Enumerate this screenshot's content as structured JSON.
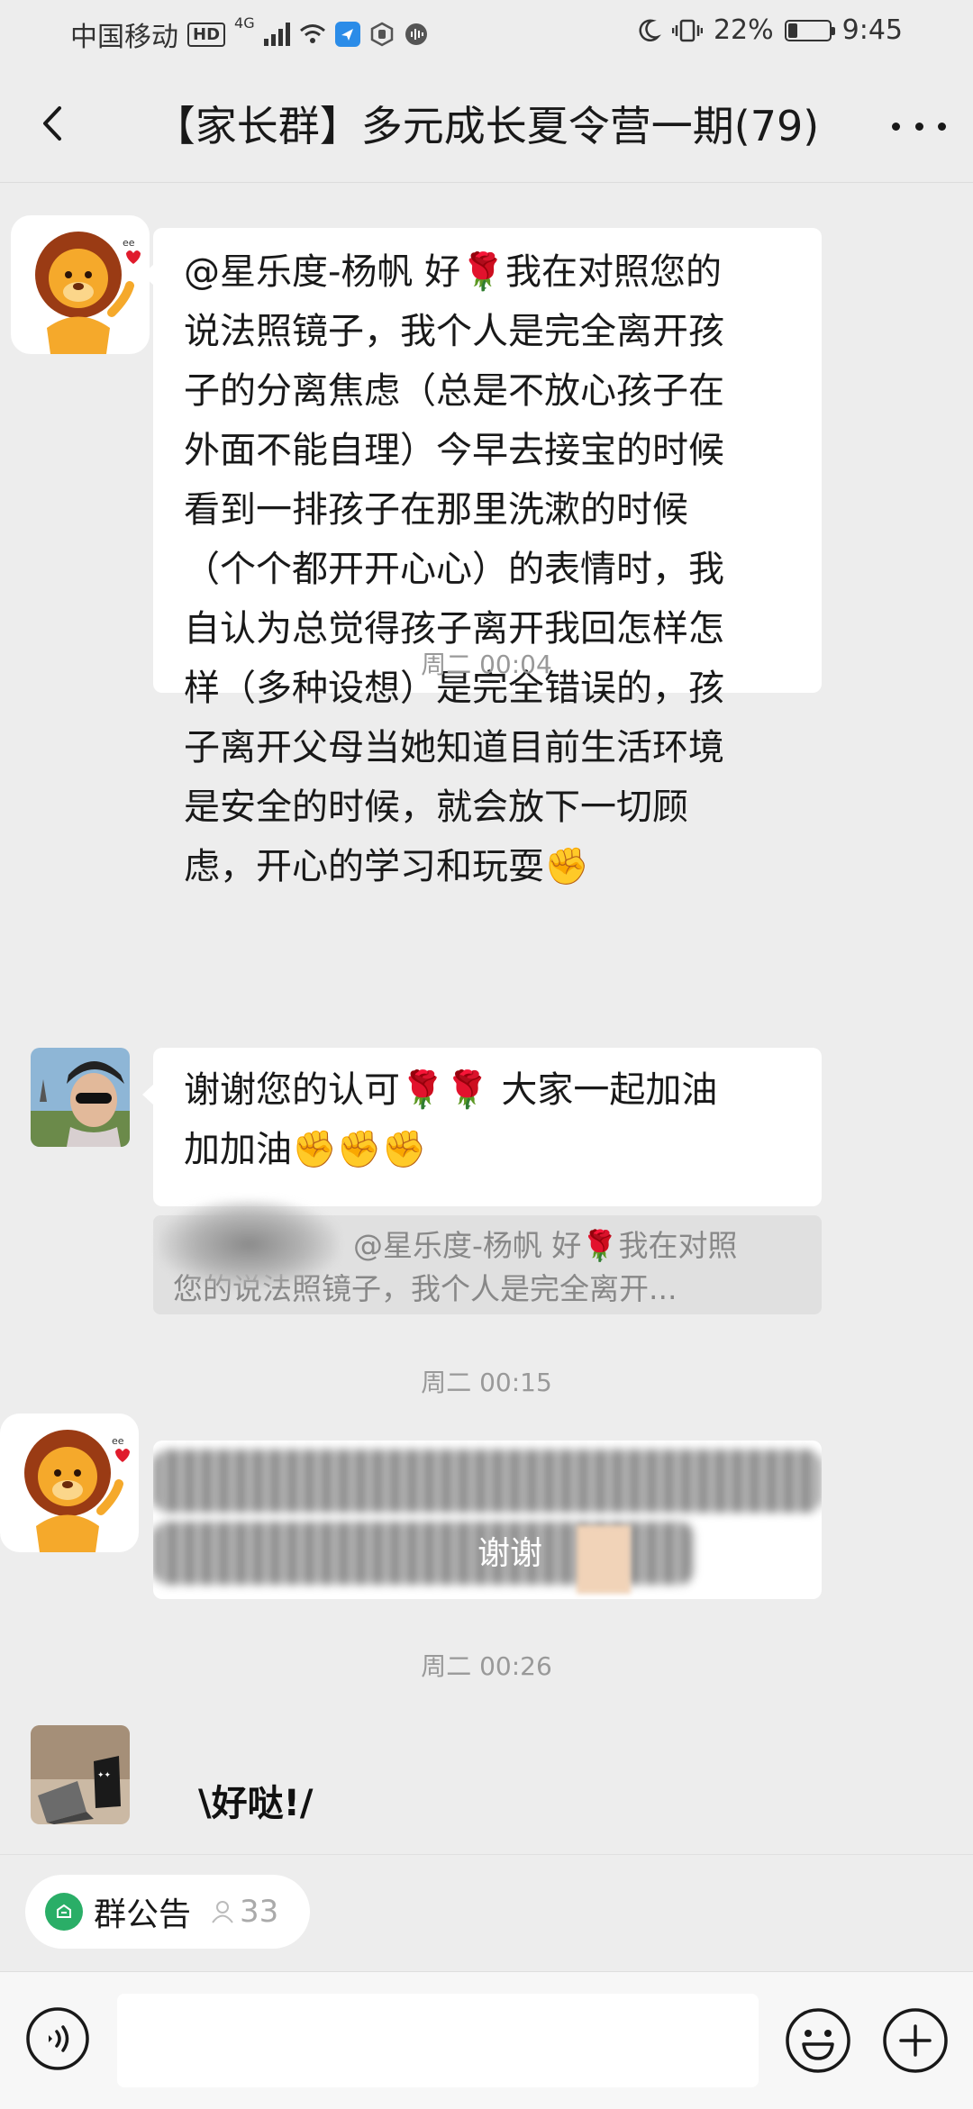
{
  "status_bar": {
    "carrier": "中国移动",
    "hd": "HD",
    "network": "4G",
    "battery_percent": "22%",
    "battery_level": 0.22,
    "time": "9:45"
  },
  "nav": {
    "title": "【家长群】多元成长夏令营一期(79)"
  },
  "messages": [
    {
      "sender_avatar": "lion-avatar",
      "lines": [
        "@星乐度-杨帆  好🌹我在对照您的",
        "说法照镜子，我个人是完全离开孩",
        "子的分离焦虑（总是不放心孩子在",
        "外面不能自理）今早去接宝的时候",
        "看到一排孩子在那里洗漱的时候",
        "（个个都开开心心）的表情时，我",
        "自认为总觉得孩子离开我回怎样怎",
        "样（多种设想）是完全错误的，孩",
        "子离开父母当她知道目前生活环境",
        "是安全的时候，就会放下一切顾",
        "虑，开心的学习和玩耍✊"
      ]
    },
    {
      "sender_avatar": "photo-avatar-woman",
      "lines": [
        "谢谢您的认可🌹🌹 大家一起加油",
        "加加油✊✊✊"
      ],
      "quote_lines": [
        "@星乐度-杨帆 好🌹我在对照",
        "您的说法照镜子，我个人是完全离开..."
      ]
    },
    {
      "sender_avatar": "lion-avatar",
      "visible_fragment": "谢谢"
    },
    {
      "sender_avatar": "photo-avatar-laptop",
      "sticker_text": "\\好哒!/"
    }
  ],
  "timestamps": [
    "周二 00:04",
    "周二 00:15",
    "周二 00:26"
  ],
  "announcement": {
    "label": "群公告",
    "count": "33"
  },
  "input": {
    "placeholder": ""
  },
  "colors": {
    "background": "#ededed",
    "bubble": "#ffffff",
    "announcement_icon": "#2aae67"
  }
}
